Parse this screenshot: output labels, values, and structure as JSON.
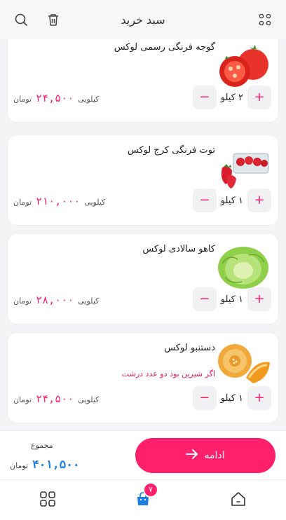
{
  "header": {
    "title": "سبد خرید"
  },
  "items": [
    {
      "name": "گوجه فرنگی رسمی لوکس",
      "qty": "۲ کیلو",
      "unit_label": "کیلویی",
      "price": "۲۴,۵۰۰",
      "currency": "تومان",
      "note": "",
      "image": "tomato"
    },
    {
      "name": "توت فرنگی کرج لوکس",
      "qty": "۱ کیلو",
      "unit_label": "کیلویی",
      "price": "۲۱۰,۰۰۰",
      "currency": "تومان",
      "note": "",
      "image": "strawberry"
    },
    {
      "name": "کاهو سالادی لوکس",
      "qty": "۱ کیلو",
      "unit_label": "کیلویی",
      "price": "۲۸,۰۰۰",
      "currency": "تومان",
      "note": "",
      "image": "lettuce"
    },
    {
      "name": "دستنبو لوکس",
      "qty": "۱ کیلو",
      "unit_label": "کیلویی",
      "price": "۲۴,۵۰۰",
      "currency": "تومان",
      "note": "اگر شیرین بود دو عدد درشت",
      "image": "melon"
    }
  ],
  "footer": {
    "total_label": "مجموع",
    "total_value": "۴۰۱,۵۰۰",
    "total_currency": "تومان",
    "continue_label": "ادامه"
  },
  "bottom_nav": {
    "cart_badge": "۷"
  },
  "colors": {
    "accent": "#ff1f6a",
    "total": "#1a7fe0"
  }
}
